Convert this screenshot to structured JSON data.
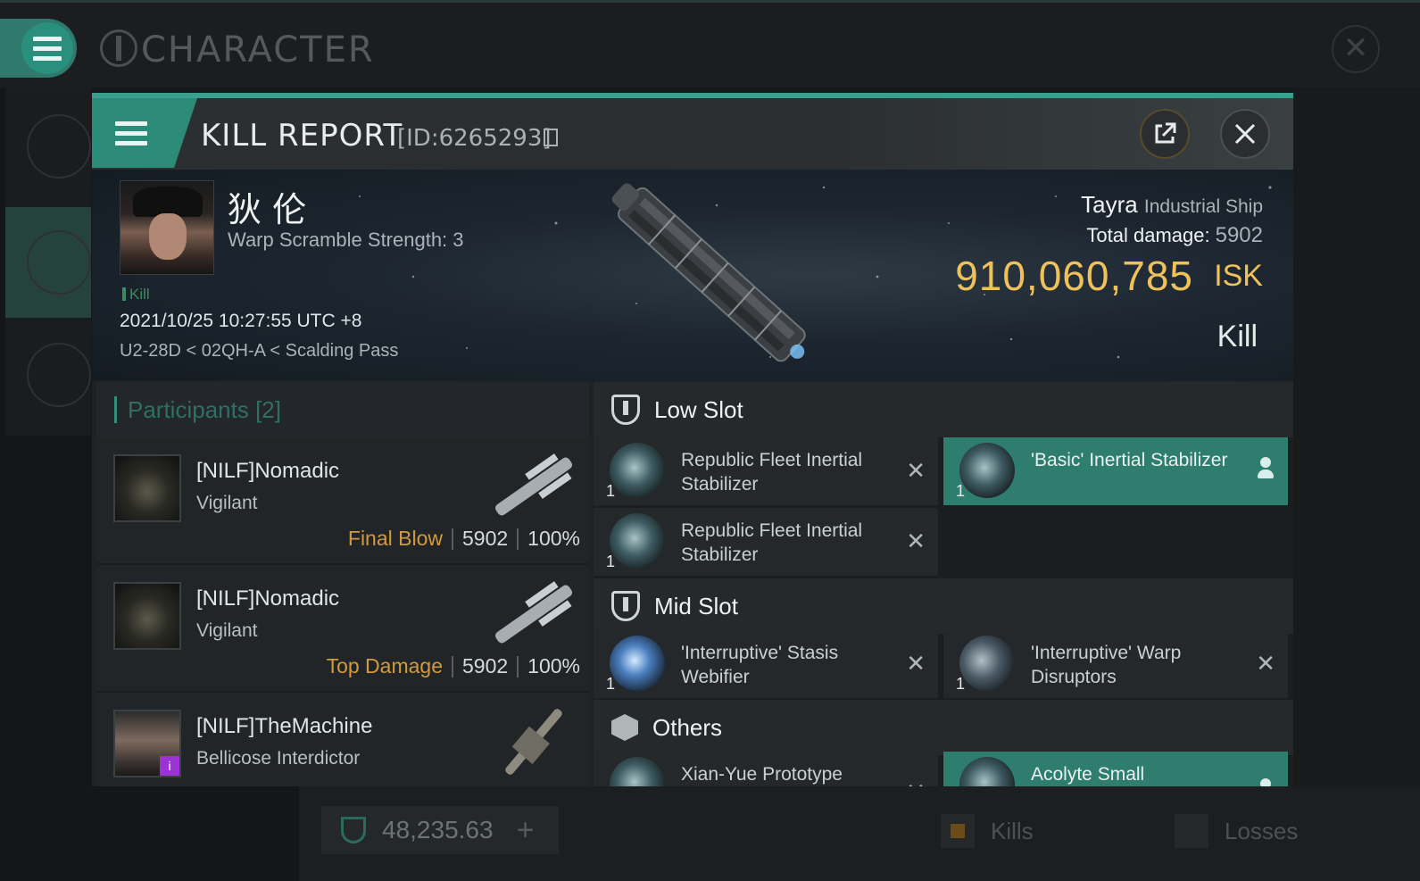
{
  "app": {
    "window_title": "CHARACTER"
  },
  "kill_report": {
    "title": "KILL REPORT",
    "id_label": "[ID:6265293]",
    "victim": {
      "name": "狄 伦",
      "subtitle": "Warp Scramble Strength: 3",
      "tag": "Kill",
      "time": "2021/10/25 10:27:55 UTC +8",
      "location": "U2-28D < 02QH-A < Scalding Pass"
    },
    "ship": {
      "name": "Tayra",
      "class": "Industrial Ship",
      "total_damage_label": "Total damage:",
      "total_damage": "5902",
      "isk_value": "910,060,785",
      "isk_unit": "ISK",
      "result": "Kill"
    },
    "participants": {
      "header": "Participants [2]",
      "rows": [
        {
          "name": "[NILF]Nomadic",
          "ship": "Vigilant",
          "tag": "Final Blow",
          "damage": "5902",
          "percent": "100%"
        },
        {
          "name": "[NILF]Nomadic",
          "ship": "Vigilant",
          "tag": "Top Damage",
          "damage": "5902",
          "percent": "100%"
        },
        {
          "name": "[NILF]TheMachine",
          "ship": "Bellicose Interdictor",
          "badge": "i"
        }
      ]
    },
    "fitting": {
      "low_slot_label": "Low Slot",
      "mid_slot_label": "Mid Slot",
      "others_label": "Others",
      "low_items": [
        {
          "name": "Republic Fleet Inertial Stabilizer",
          "qty": "1",
          "state": "destroyed"
        },
        {
          "name": "'Basic' Inertial Stabilizer",
          "qty": "1",
          "state": "dropped"
        },
        {
          "name": "Republic Fleet Inertial Stabilizer",
          "qty": "1",
          "state": "destroyed"
        }
      ],
      "mid_items": [
        {
          "name": "'Interruptive' Stasis Webifier",
          "qty": "1",
          "state": "destroyed"
        },
        {
          "name": "'Interruptive' Warp Disruptors",
          "qty": "1",
          "state": "destroyed"
        }
      ],
      "other_items": [
        {
          "name": "Xian-Yue Prototype",
          "state": "destroyed"
        },
        {
          "name": "Acolyte Small",
          "state": "dropped"
        }
      ]
    }
  },
  "footer": {
    "wallet_value": "48,235.63",
    "kills_label": "Kills",
    "losses_label": "Losses"
  },
  "colors": {
    "accent": "#2f8f7c",
    "isk": "#efc15a",
    "final_blow": "#d19a3e",
    "dropped_bg": "#2f7d6f"
  }
}
